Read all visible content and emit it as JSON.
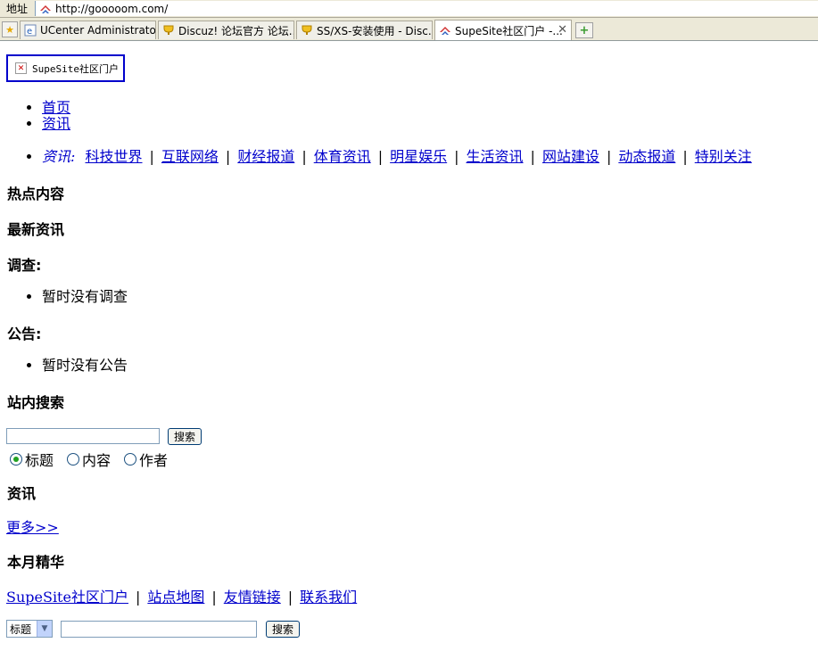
{
  "browser": {
    "address_label": "地址",
    "url": "http://gooooom.com/",
    "tabs": [
      {
        "label": "UCenter Administrator'..."
      },
      {
        "label": "Discuz! 论坛官方 论坛..."
      },
      {
        "label": "SS/XS-安装使用 - Disc..."
      },
      {
        "label": "SupeSite社区门户 -..."
      }
    ]
  },
  "page": {
    "logo_text": "SupeSite社区门户",
    "nav": [
      "首页",
      "资讯"
    ],
    "category_head": "资讯:",
    "categories": [
      "科技世界",
      "互联网络",
      "财经报道",
      "体育资讯",
      "明星娱乐",
      "生活资讯",
      "网站建设",
      "动态报道",
      "特别关注"
    ],
    "separator": "|",
    "hot_title": "热点内容",
    "latest_title": "最新资讯",
    "poll_title": "调查:",
    "poll_empty": "暂时没有调查",
    "notice_title": "公告:",
    "notice_empty": "暂时没有公告",
    "search_title": "站内搜索",
    "search_button": "搜索",
    "search_options": [
      "标题",
      "内容",
      "作者"
    ],
    "news_title": "资讯",
    "more_link": "更多>>",
    "monthly_title": "本月精华",
    "footer_links": [
      "SupeSite社区门户",
      "站点地图",
      "友情链接",
      "联系我们"
    ],
    "bottom_select": "标题",
    "bottom_button": "搜索"
  }
}
